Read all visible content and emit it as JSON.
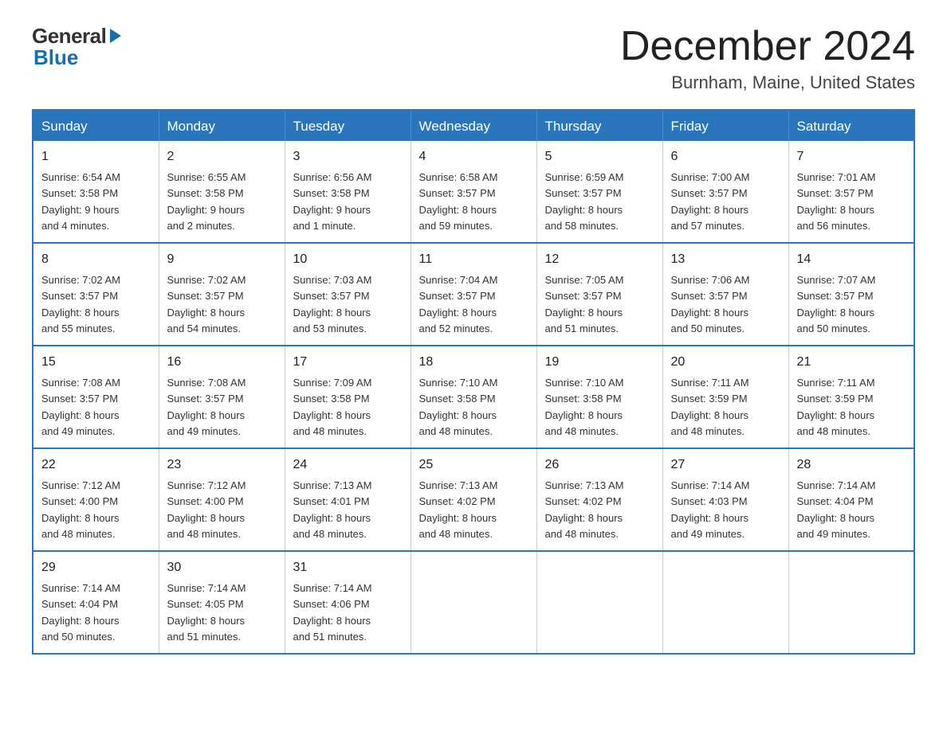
{
  "logo": {
    "text_general": "General",
    "text_blue": "Blue",
    "arrow": "▶"
  },
  "header": {
    "month_year": "December 2024",
    "location": "Burnham, Maine, United States"
  },
  "days_of_week": [
    "Sunday",
    "Monday",
    "Tuesday",
    "Wednesday",
    "Thursday",
    "Friday",
    "Saturday"
  ],
  "weeks": [
    [
      {
        "day": "1",
        "sunrise": "6:54 AM",
        "sunset": "3:58 PM",
        "daylight": "9 hours and 4 minutes."
      },
      {
        "day": "2",
        "sunrise": "6:55 AM",
        "sunset": "3:58 PM",
        "daylight": "9 hours and 2 minutes."
      },
      {
        "day": "3",
        "sunrise": "6:56 AM",
        "sunset": "3:58 PM",
        "daylight": "9 hours and 1 minute."
      },
      {
        "day": "4",
        "sunrise": "6:58 AM",
        "sunset": "3:57 PM",
        "daylight": "8 hours and 59 minutes."
      },
      {
        "day": "5",
        "sunrise": "6:59 AM",
        "sunset": "3:57 PM",
        "daylight": "8 hours and 58 minutes."
      },
      {
        "day": "6",
        "sunrise": "7:00 AM",
        "sunset": "3:57 PM",
        "daylight": "8 hours and 57 minutes."
      },
      {
        "day": "7",
        "sunrise": "7:01 AM",
        "sunset": "3:57 PM",
        "daylight": "8 hours and 56 minutes."
      }
    ],
    [
      {
        "day": "8",
        "sunrise": "7:02 AM",
        "sunset": "3:57 PM",
        "daylight": "8 hours and 55 minutes."
      },
      {
        "day": "9",
        "sunrise": "7:02 AM",
        "sunset": "3:57 PM",
        "daylight": "8 hours and 54 minutes."
      },
      {
        "day": "10",
        "sunrise": "7:03 AM",
        "sunset": "3:57 PM",
        "daylight": "8 hours and 53 minutes."
      },
      {
        "day": "11",
        "sunrise": "7:04 AM",
        "sunset": "3:57 PM",
        "daylight": "8 hours and 52 minutes."
      },
      {
        "day": "12",
        "sunrise": "7:05 AM",
        "sunset": "3:57 PM",
        "daylight": "8 hours and 51 minutes."
      },
      {
        "day": "13",
        "sunrise": "7:06 AM",
        "sunset": "3:57 PM",
        "daylight": "8 hours and 50 minutes."
      },
      {
        "day": "14",
        "sunrise": "7:07 AM",
        "sunset": "3:57 PM",
        "daylight": "8 hours and 50 minutes."
      }
    ],
    [
      {
        "day": "15",
        "sunrise": "7:08 AM",
        "sunset": "3:57 PM",
        "daylight": "8 hours and 49 minutes."
      },
      {
        "day": "16",
        "sunrise": "7:08 AM",
        "sunset": "3:57 PM",
        "daylight": "8 hours and 49 minutes."
      },
      {
        "day": "17",
        "sunrise": "7:09 AM",
        "sunset": "3:58 PM",
        "daylight": "8 hours and 48 minutes."
      },
      {
        "day": "18",
        "sunrise": "7:10 AM",
        "sunset": "3:58 PM",
        "daylight": "8 hours and 48 minutes."
      },
      {
        "day": "19",
        "sunrise": "7:10 AM",
        "sunset": "3:58 PM",
        "daylight": "8 hours and 48 minutes."
      },
      {
        "day": "20",
        "sunrise": "7:11 AM",
        "sunset": "3:59 PM",
        "daylight": "8 hours and 48 minutes."
      },
      {
        "day": "21",
        "sunrise": "7:11 AM",
        "sunset": "3:59 PM",
        "daylight": "8 hours and 48 minutes."
      }
    ],
    [
      {
        "day": "22",
        "sunrise": "7:12 AM",
        "sunset": "4:00 PM",
        "daylight": "8 hours and 48 minutes."
      },
      {
        "day": "23",
        "sunrise": "7:12 AM",
        "sunset": "4:00 PM",
        "daylight": "8 hours and 48 minutes."
      },
      {
        "day": "24",
        "sunrise": "7:13 AM",
        "sunset": "4:01 PM",
        "daylight": "8 hours and 48 minutes."
      },
      {
        "day": "25",
        "sunrise": "7:13 AM",
        "sunset": "4:02 PM",
        "daylight": "8 hours and 48 minutes."
      },
      {
        "day": "26",
        "sunrise": "7:13 AM",
        "sunset": "4:02 PM",
        "daylight": "8 hours and 48 minutes."
      },
      {
        "day": "27",
        "sunrise": "7:14 AM",
        "sunset": "4:03 PM",
        "daylight": "8 hours and 49 minutes."
      },
      {
        "day": "28",
        "sunrise": "7:14 AM",
        "sunset": "4:04 PM",
        "daylight": "8 hours and 49 minutes."
      }
    ],
    [
      {
        "day": "29",
        "sunrise": "7:14 AM",
        "sunset": "4:04 PM",
        "daylight": "8 hours and 50 minutes."
      },
      {
        "day": "30",
        "sunrise": "7:14 AM",
        "sunset": "4:05 PM",
        "daylight": "8 hours and 51 minutes."
      },
      {
        "day": "31",
        "sunrise": "7:14 AM",
        "sunset": "4:06 PM",
        "daylight": "8 hours and 51 minutes."
      },
      null,
      null,
      null,
      null
    ]
  ],
  "labels": {
    "sunrise": "Sunrise:",
    "sunset": "Sunset:",
    "daylight": "Daylight:"
  }
}
